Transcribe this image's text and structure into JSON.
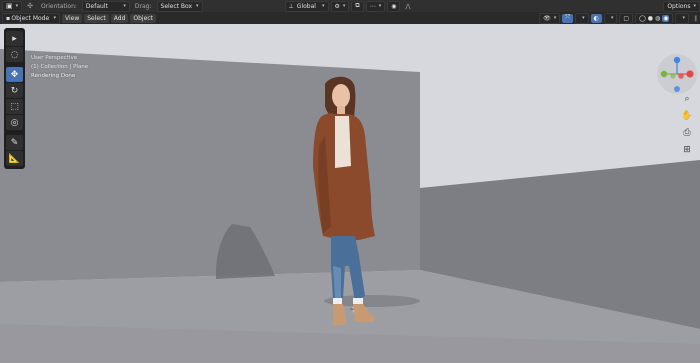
{
  "topbar": {
    "orientation_label": "Orientation:",
    "orientation_value": "Default",
    "drag_label": "Drag:",
    "drag_value": "Select Box",
    "transform_space": "Global",
    "options_label": "Options"
  },
  "header": {
    "mode": "Object Mode",
    "menus": [
      "View",
      "Select",
      "Add",
      "Object"
    ]
  },
  "overlay": {
    "line1": "User Perspective",
    "line2": "(1) Collection | Plane",
    "line3": "Rendering Done"
  },
  "tools": [
    "select-box-icon",
    "select-circle-icon",
    "move-icon",
    "rotate-icon",
    "scale-icon",
    "transform-icon",
    "annotate-icon",
    "measure-icon"
  ],
  "gizmo": {
    "x_color": "#e24a4a",
    "y_color": "#7bb33b",
    "z_color": "#3f86e6"
  },
  "nav_icons": [
    "zoom-icon",
    "pan-hand-icon",
    "camera-icon",
    "grid-icon"
  ],
  "colors": {
    "accent": "#4772b3",
    "sky": "#d7d8de",
    "left_wall": "#8c8d93",
    "right_wall": "#7d7e84",
    "floor": "#9c9da3"
  }
}
